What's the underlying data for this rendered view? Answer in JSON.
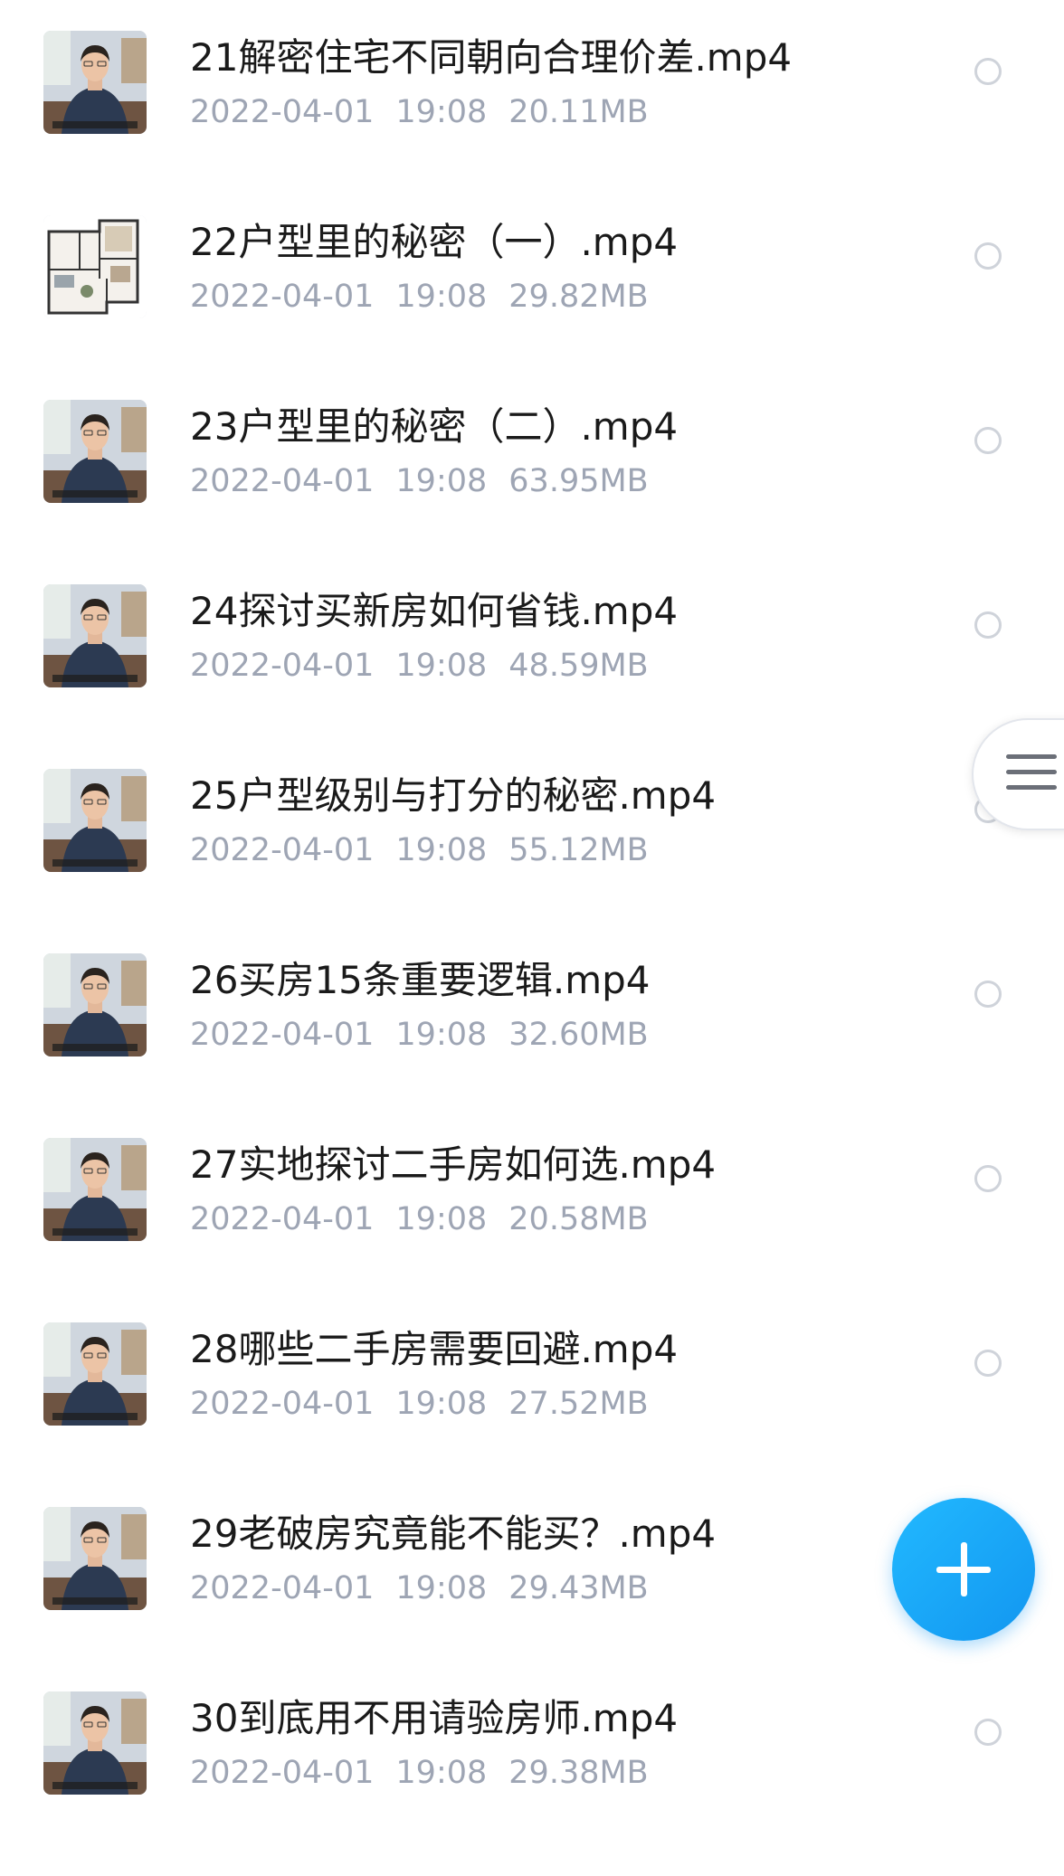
{
  "files": [
    {
      "name": "21解密住宅不同朝向合理价差.mp4",
      "date": "2022-04-01",
      "time": "19:08",
      "size": "20.11MB",
      "thumb_icon": "video-thumbnail-icon"
    },
    {
      "name": "22户型里的秘密（一）.mp4",
      "date": "2022-04-01",
      "time": "19:08",
      "size": "29.82MB",
      "thumb_icon": "floorplan-thumbnail-icon"
    },
    {
      "name": "23户型里的秘密（二）.mp4",
      "date": "2022-04-01",
      "time": "19:08",
      "size": "63.95MB",
      "thumb_icon": "video-thumbnail-icon"
    },
    {
      "name": "24探讨买新房如何省钱.mp4",
      "date": "2022-04-01",
      "time": "19:08",
      "size": "48.59MB",
      "thumb_icon": "video-thumbnail-icon"
    },
    {
      "name": "25户型级别与打分的秘密.mp4",
      "date": "2022-04-01",
      "time": "19:08",
      "size": "55.12MB",
      "thumb_icon": "video-thumbnail-icon"
    },
    {
      "name": "26买房15条重要逻辑.mp4",
      "date": "2022-04-01",
      "time": "19:08",
      "size": "32.60MB",
      "thumb_icon": "video-thumbnail-icon"
    },
    {
      "name": "27实地探讨二手房如何选.mp4",
      "date": "2022-04-01",
      "time": "19:08",
      "size": "20.58MB",
      "thumb_icon": "video-thumbnail-icon"
    },
    {
      "name": "28哪些二手房需要回避.mp4",
      "date": "2022-04-01",
      "time": "19:08",
      "size": "27.52MB",
      "thumb_icon": "video-thumbnail-icon"
    },
    {
      "name": "29老破房究竟能不能买？.mp4",
      "date": "2022-04-01",
      "time": "19:08",
      "size": "29.43MB",
      "thumb_icon": "video-thumbnail-icon"
    },
    {
      "name": "30到底用不用请验房师.mp4",
      "date": "2022-04-01",
      "time": "19:08",
      "size": "29.38MB",
      "thumb_icon": "video-thumbnail-icon"
    }
  ],
  "side_handle": {
    "icon": "menu-icon"
  },
  "fab": {
    "icon": "plus-icon",
    "color": "#1aa7fa"
  },
  "colors": {
    "name_text": "#1a1a1a",
    "meta_text": "#9ea5b4",
    "radio_border": "#cfd3da"
  }
}
